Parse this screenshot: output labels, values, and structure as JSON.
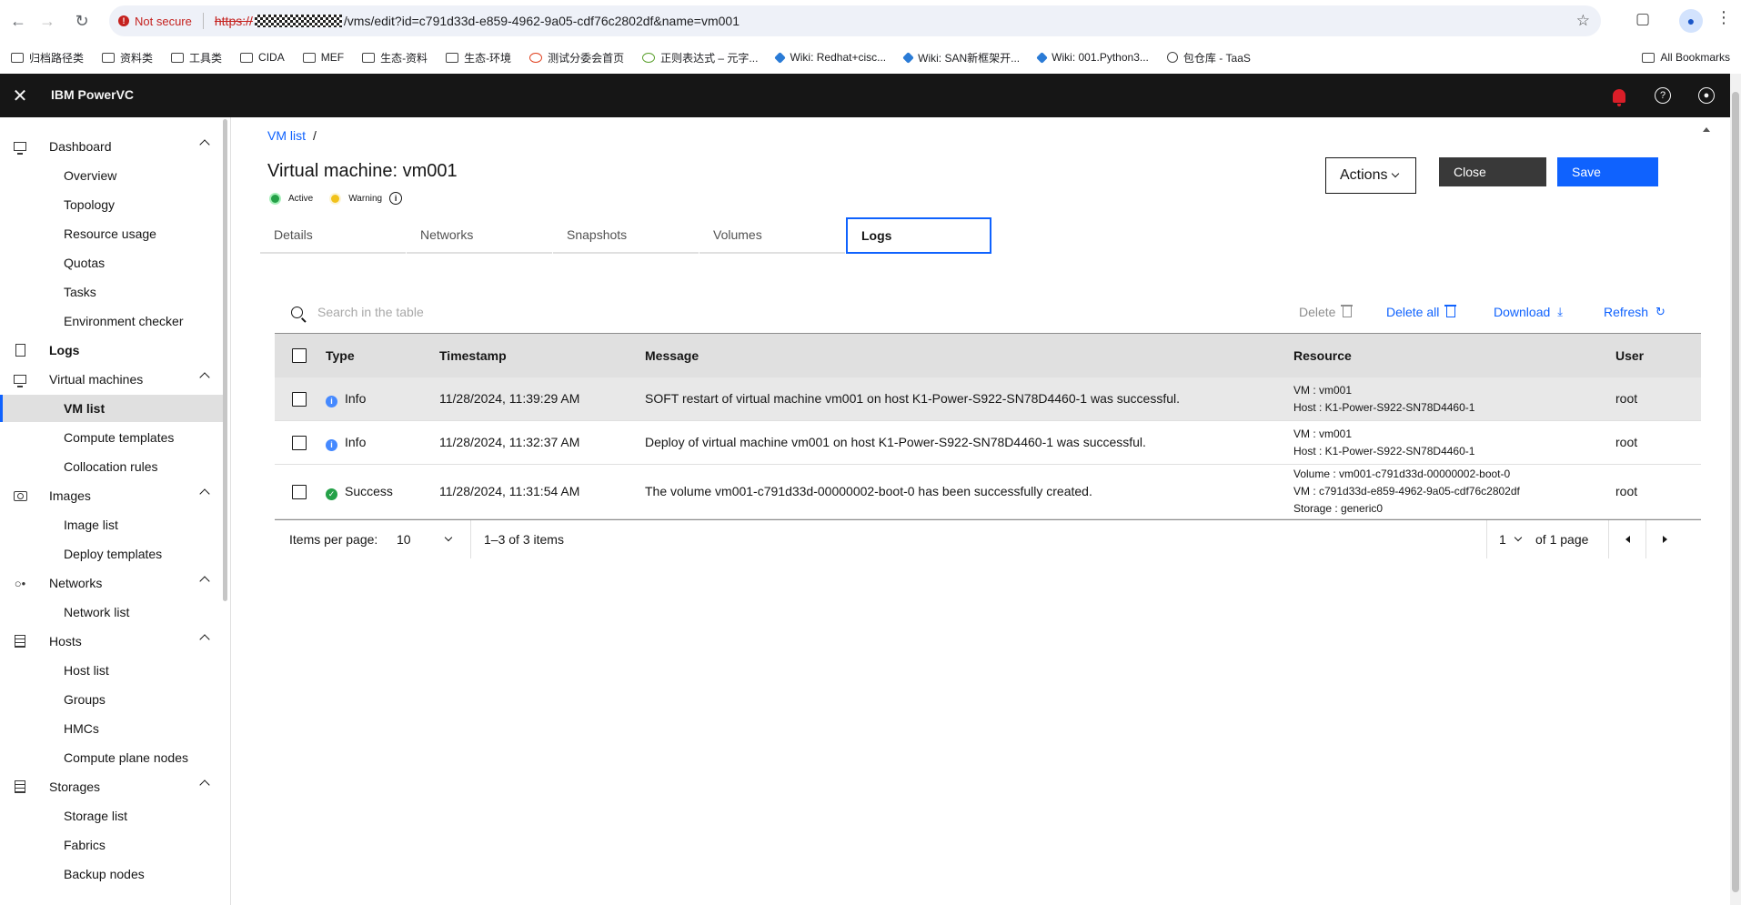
{
  "browser": {
    "not_secure": "Not secure",
    "url_scheme": "https://",
    "url_rest": "/vms/edit?id=c791d33d-e859-4962-9a05-cdf76c2802df&name=vm001",
    "bookmarks": [
      "归档路径类",
      "资料类",
      "工具类",
      "CIDA",
      "MEF",
      "生态-资料",
      "生态-环境",
      "测试分委会首页",
      "正则表达式 – 元字...",
      "Wiki: Redhat+cisc...",
      "Wiki: SAN新框架开...",
      "Wiki: 001.Python3...",
      "包仓库 - TaaS"
    ],
    "all_bookmarks": "All Bookmarks"
  },
  "app": {
    "title": "IBM PowerVC"
  },
  "sidebar": {
    "dashboard": "Dashboard",
    "overview": "Overview",
    "topology": "Topology",
    "resource_usage": "Resource usage",
    "quotas": "Quotas",
    "tasks": "Tasks",
    "environment_checker": "Environment checker",
    "logs": "Logs",
    "virtual_machines": "Virtual machines",
    "vm_list": "VM list",
    "compute_templates": "Compute templates",
    "collocation_rules": "Collocation rules",
    "images": "Images",
    "image_list": "Image list",
    "deploy_templates": "Deploy templates",
    "networks": "Networks",
    "network_list": "Network list",
    "hosts": "Hosts",
    "host_list": "Host list",
    "groups": "Groups",
    "hmcs": "HMCs",
    "compute_plane_nodes": "Compute plane nodes",
    "storages": "Storages",
    "storage_list": "Storage list",
    "fabrics": "Fabrics",
    "backup_nodes": "Backup nodes"
  },
  "page": {
    "breadcrumb": "VM list",
    "breadcrumb_sep": "/",
    "title": "Virtual machine: vm001",
    "status_active": "Active",
    "status_warning": "Warning",
    "actions": "Actions",
    "close": "Close",
    "save": "Save",
    "tabs": [
      "Details",
      "Networks",
      "Snapshots",
      "Volumes",
      "Logs"
    ]
  },
  "table": {
    "search_placeholder": "Search in the table",
    "delete": "Delete",
    "delete_all": "Delete all",
    "download": "Download",
    "refresh": "Refresh",
    "headers": {
      "type": "Type",
      "timestamp": "Timestamp",
      "message": "Message",
      "resource": "Resource",
      "user": "User"
    },
    "rows": [
      {
        "type": "Info",
        "timestamp": "11/28/2024, 11:39:29 AM",
        "message": "SOFT restart of virtual machine vm001 on host K1-Power-S922-SN78D4460-1 was successful.",
        "resource": [
          "VM : vm001",
          "Host : K1-Power-S922-SN78D4460-1"
        ],
        "user": "root"
      },
      {
        "type": "Info",
        "timestamp": "11/28/2024, 11:32:37 AM",
        "message": "Deploy of virtual machine vm001 on host K1-Power-S922-SN78D4460-1 was successful.",
        "resource": [
          "VM : vm001",
          "Host : K1-Power-S922-SN78D4460-1"
        ],
        "user": "root"
      },
      {
        "type": "Success",
        "timestamp": "11/28/2024, 11:31:54 AM",
        "message": "The volume vm001-c791d33d-00000002-boot-0 has been successfully created.",
        "resource": [
          "Volume : vm001-c791d33d-00000002-boot-0",
          "VM : c791d33d-e859-4962-9a05-cdf76c2802df",
          "Storage : generic0"
        ],
        "user": "root"
      }
    ],
    "pagination": {
      "items_per_page_label": "Items per page:",
      "items_per_page": "10",
      "range": "1–3 of 3 items",
      "page": "1",
      "of_pages": "of 1 page"
    }
  },
  "colors": {
    "primary": "#0f62fe",
    "header": "#161616",
    "success": "#24a148",
    "warning": "#f1c21b",
    "alert": "#da1e28"
  }
}
